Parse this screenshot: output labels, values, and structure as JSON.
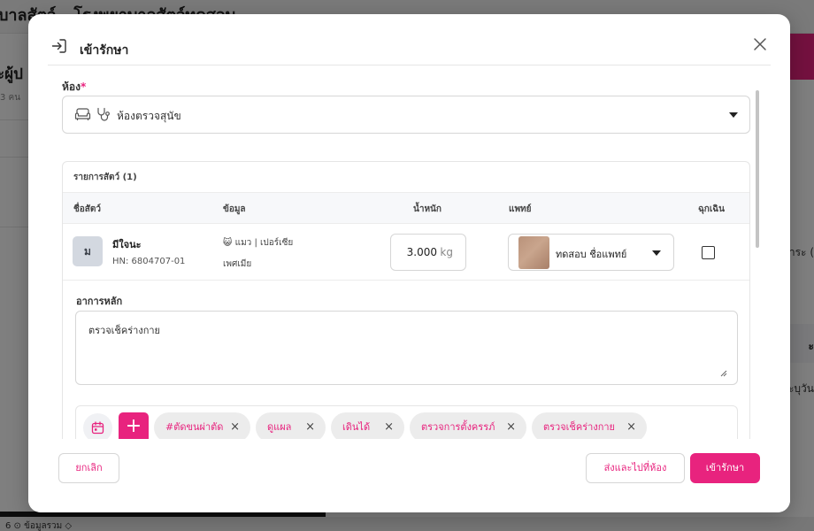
{
  "background": {
    "app_title": "บาลสัตว์ - โรงพยาบาลสัตว์ทดสอบ",
    "side_heading": "ะผู้ป",
    "side_sub": "3 คน",
    "right_snippet_1": "าระ (",
    "right_snippet_2": "ะ",
    "right_snippet_3": "ะบุวัน",
    "footer_text": "6   ⊙ ข้อมูลรวม ◇"
  },
  "modal": {
    "header_icon": "login-icon",
    "title": "เข้ารักษา",
    "close_icon": "close-icon",
    "room": {
      "label": "ห้อง",
      "required_mark": "*",
      "value": "ห้องตรวจสุนัข",
      "icons": [
        "sofa-icon",
        "stethoscope-icon"
      ]
    },
    "pets": {
      "title": "รายการสัตว์ (1)",
      "columns": {
        "name": "ชื่อสัตว์",
        "info": "ข้อมูล",
        "weight": "น้ำหนัก",
        "doctor": "แพทย์",
        "emergency": "ฉุกเฉิน"
      },
      "rows": [
        {
          "avatar_letter": "ม",
          "name": "มีใจนะ",
          "hn": "HN: 6804707-01",
          "species_emoji": "😺",
          "species_breed": "แมว | เปอร์เซีย",
          "sex": "เพศเมีย",
          "weight": "3.000",
          "weight_unit": "kg",
          "doctor": "ทดสอบ ชื่อแพทย์",
          "emergency_checked": false
        }
      ]
    },
    "symptom": {
      "label": "อาการหลัก",
      "value": "ตรวจเช็คร่างกาย"
    },
    "tags": {
      "add_label": "+",
      "items": [
        "#ตัดขนผ่าตัด",
        "ดูแผล",
        "เดินได้",
        "ตรวจการตั้งครรภ์",
        "ตรวจเช็คร่างกาย"
      ],
      "remove_glyph": "×"
    },
    "footer": {
      "cancel": "ยกเลิก",
      "send_to_room": "ส่งและไปที่ห้อง",
      "admit": "เข้ารักษา"
    }
  },
  "colors": {
    "accent": "#e8237e",
    "overlay": "rgba(0,0,0,0.5)"
  }
}
